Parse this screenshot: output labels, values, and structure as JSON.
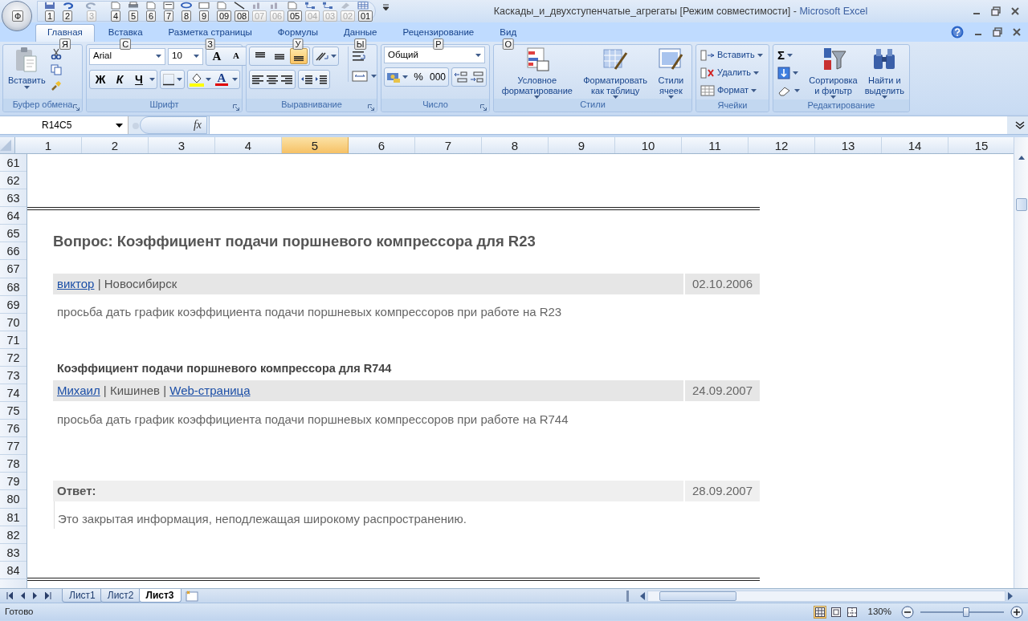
{
  "title_bar": {
    "office_keytip": "Ф",
    "document": "Каскады_и_двухступенчатые_агрегаты  [Режим совместимости]",
    "separator": "-",
    "app": "Microsoft Excel",
    "qat": [
      {
        "keytip": "1",
        "disabled": false
      },
      {
        "keytip": "2",
        "disabled": false
      },
      {
        "keytip": "3",
        "disabled": true
      },
      {
        "keytip": "4",
        "disabled": false
      },
      {
        "keytip": "5",
        "disabled": false
      },
      {
        "keytip": "6",
        "disabled": false
      },
      {
        "keytip": "7",
        "disabled": false
      },
      {
        "keytip": "8",
        "disabled": false
      },
      {
        "keytip": "9",
        "disabled": false
      },
      {
        "keytip": "09",
        "disabled": false
      },
      {
        "keytip": "08",
        "disabled": false
      },
      {
        "keytip": "07",
        "disabled": true
      },
      {
        "keytip": "06",
        "disabled": true
      },
      {
        "keytip": "05",
        "disabled": false
      },
      {
        "keytip": "04",
        "disabled": true
      },
      {
        "keytip": "03",
        "disabled": true
      },
      {
        "keytip": "02",
        "disabled": true
      },
      {
        "keytip": "01",
        "disabled": false
      }
    ]
  },
  "tabs": [
    {
      "label": "Главная",
      "keytip": "Я",
      "selected": true
    },
    {
      "label": "Вставка",
      "keytip": "С",
      "selected": false
    },
    {
      "label": "Разметка страницы",
      "keytip": "З",
      "selected": false
    },
    {
      "label": "Формулы",
      "keytip": "У",
      "selected": false
    },
    {
      "label": "Данные",
      "keytip": "Ы",
      "selected": false
    },
    {
      "label": "Рецензирование",
      "keytip": "Р",
      "selected": false
    },
    {
      "label": "Вид",
      "keytip": "О",
      "selected": false
    }
  ],
  "ribbon": {
    "clipboard": {
      "label": "Буфер обмена",
      "paste": "Вставить"
    },
    "font": {
      "label": "Шрифт",
      "font_name": "Arial",
      "font_size": "10",
      "grow": "A",
      "shrink": "A",
      "bold": "Ж",
      "italic": "К",
      "underline": "Ч",
      "font_color": "A"
    },
    "alignment": {
      "label": "Выравнивание",
      "vertical_buttons": [
        {
          "selected": false
        },
        {
          "selected": false
        },
        {
          "selected": true
        }
      ]
    },
    "number": {
      "label": "Число",
      "format": "Общий",
      "percent": "%",
      "thousands": "000"
    },
    "styles": {
      "label": "Стили",
      "buttons": [
        {
          "lines": [
            "Условное",
            "форматирование"
          ]
        },
        {
          "lines": [
            "Форматировать",
            "как таблицу"
          ]
        },
        {
          "lines": [
            "Стили",
            "ячеек"
          ]
        }
      ]
    },
    "cells": {
      "label": "Ячейки",
      "buttons": [
        "Вставить",
        "Удалить",
        "Формат"
      ]
    },
    "editing": {
      "label": "Редактирование",
      "sum": "Σ",
      "buttons": [
        {
          "lines": [
            "Сортировка",
            "и фильтр"
          ]
        },
        {
          "lines": [
            "Найти и",
            "выделить"
          ]
        }
      ]
    }
  },
  "formula_bar": {
    "name_box": "R14C5",
    "function_label": "fx"
  },
  "sheet": {
    "columns": [
      {
        "label": "1",
        "selected": false
      },
      {
        "label": "2",
        "selected": false
      },
      {
        "label": "3",
        "selected": false
      },
      {
        "label": "4",
        "selected": false
      },
      {
        "label": "5",
        "selected": true
      },
      {
        "label": "6",
        "selected": false
      },
      {
        "label": "7",
        "selected": false
      },
      {
        "label": "8",
        "selected": false
      },
      {
        "label": "9",
        "selected": false
      },
      {
        "label": "10",
        "selected": false
      },
      {
        "label": "11",
        "selected": false
      },
      {
        "label": "12",
        "selected": false
      },
      {
        "label": "13",
        "selected": false
      },
      {
        "label": "14",
        "selected": false
      },
      {
        "label": "15",
        "selected": false
      }
    ],
    "row_numbers": [
      "61",
      "62",
      "63",
      "64",
      "65",
      "66",
      "67",
      "68",
      "69",
      "70",
      "71",
      "72",
      "73",
      "74",
      "75",
      "76",
      "77",
      "78",
      "79",
      "80",
      "81",
      "82",
      "83",
      "84"
    ],
    "title": "Вопрос: Коэффициент подачи поршневого компрессора для R23",
    "posts": [
      {
        "kind": "question",
        "byline": [
          {
            "kind": "link",
            "text": "виктор"
          },
          {
            "kind": "text",
            "text": "| Новосибирск"
          }
        ],
        "date": "02.10.2006",
        "text": "просьба дать график коэффициента подачи поршневых компрессоров при работе на R23"
      },
      {
        "kind": "comment",
        "subject": "Коэффициент подачи поршневого компрессора для R744",
        "byline": [
          {
            "kind": "link",
            "text": "Михаил"
          },
          {
            "kind": "text",
            "text": "| Кишинев |"
          },
          {
            "kind": "link",
            "text": "Web-страница"
          }
        ],
        "date": "24.09.2007",
        "text": "просьба дать график коэффициента подачи поршневых компрессоров при работе на R744"
      },
      {
        "kind": "answer",
        "label": "Ответ:",
        "date": "28.09.2007",
        "text": "Это закрытая информация, неподлежащая широкому распространению."
      }
    ]
  },
  "sheet_tabs": [
    {
      "label": "Лист1",
      "selected": false
    },
    {
      "label": "Лист2",
      "selected": false
    },
    {
      "label": "Лист3",
      "selected": true
    }
  ],
  "status_bar": {
    "status": "Готово",
    "views": [
      {
        "selected": true
      },
      {
        "selected": false
      },
      {
        "selected": false
      }
    ],
    "zoom": "130%",
    "zoom_slider": {
      "level": 0.55
    }
  }
}
